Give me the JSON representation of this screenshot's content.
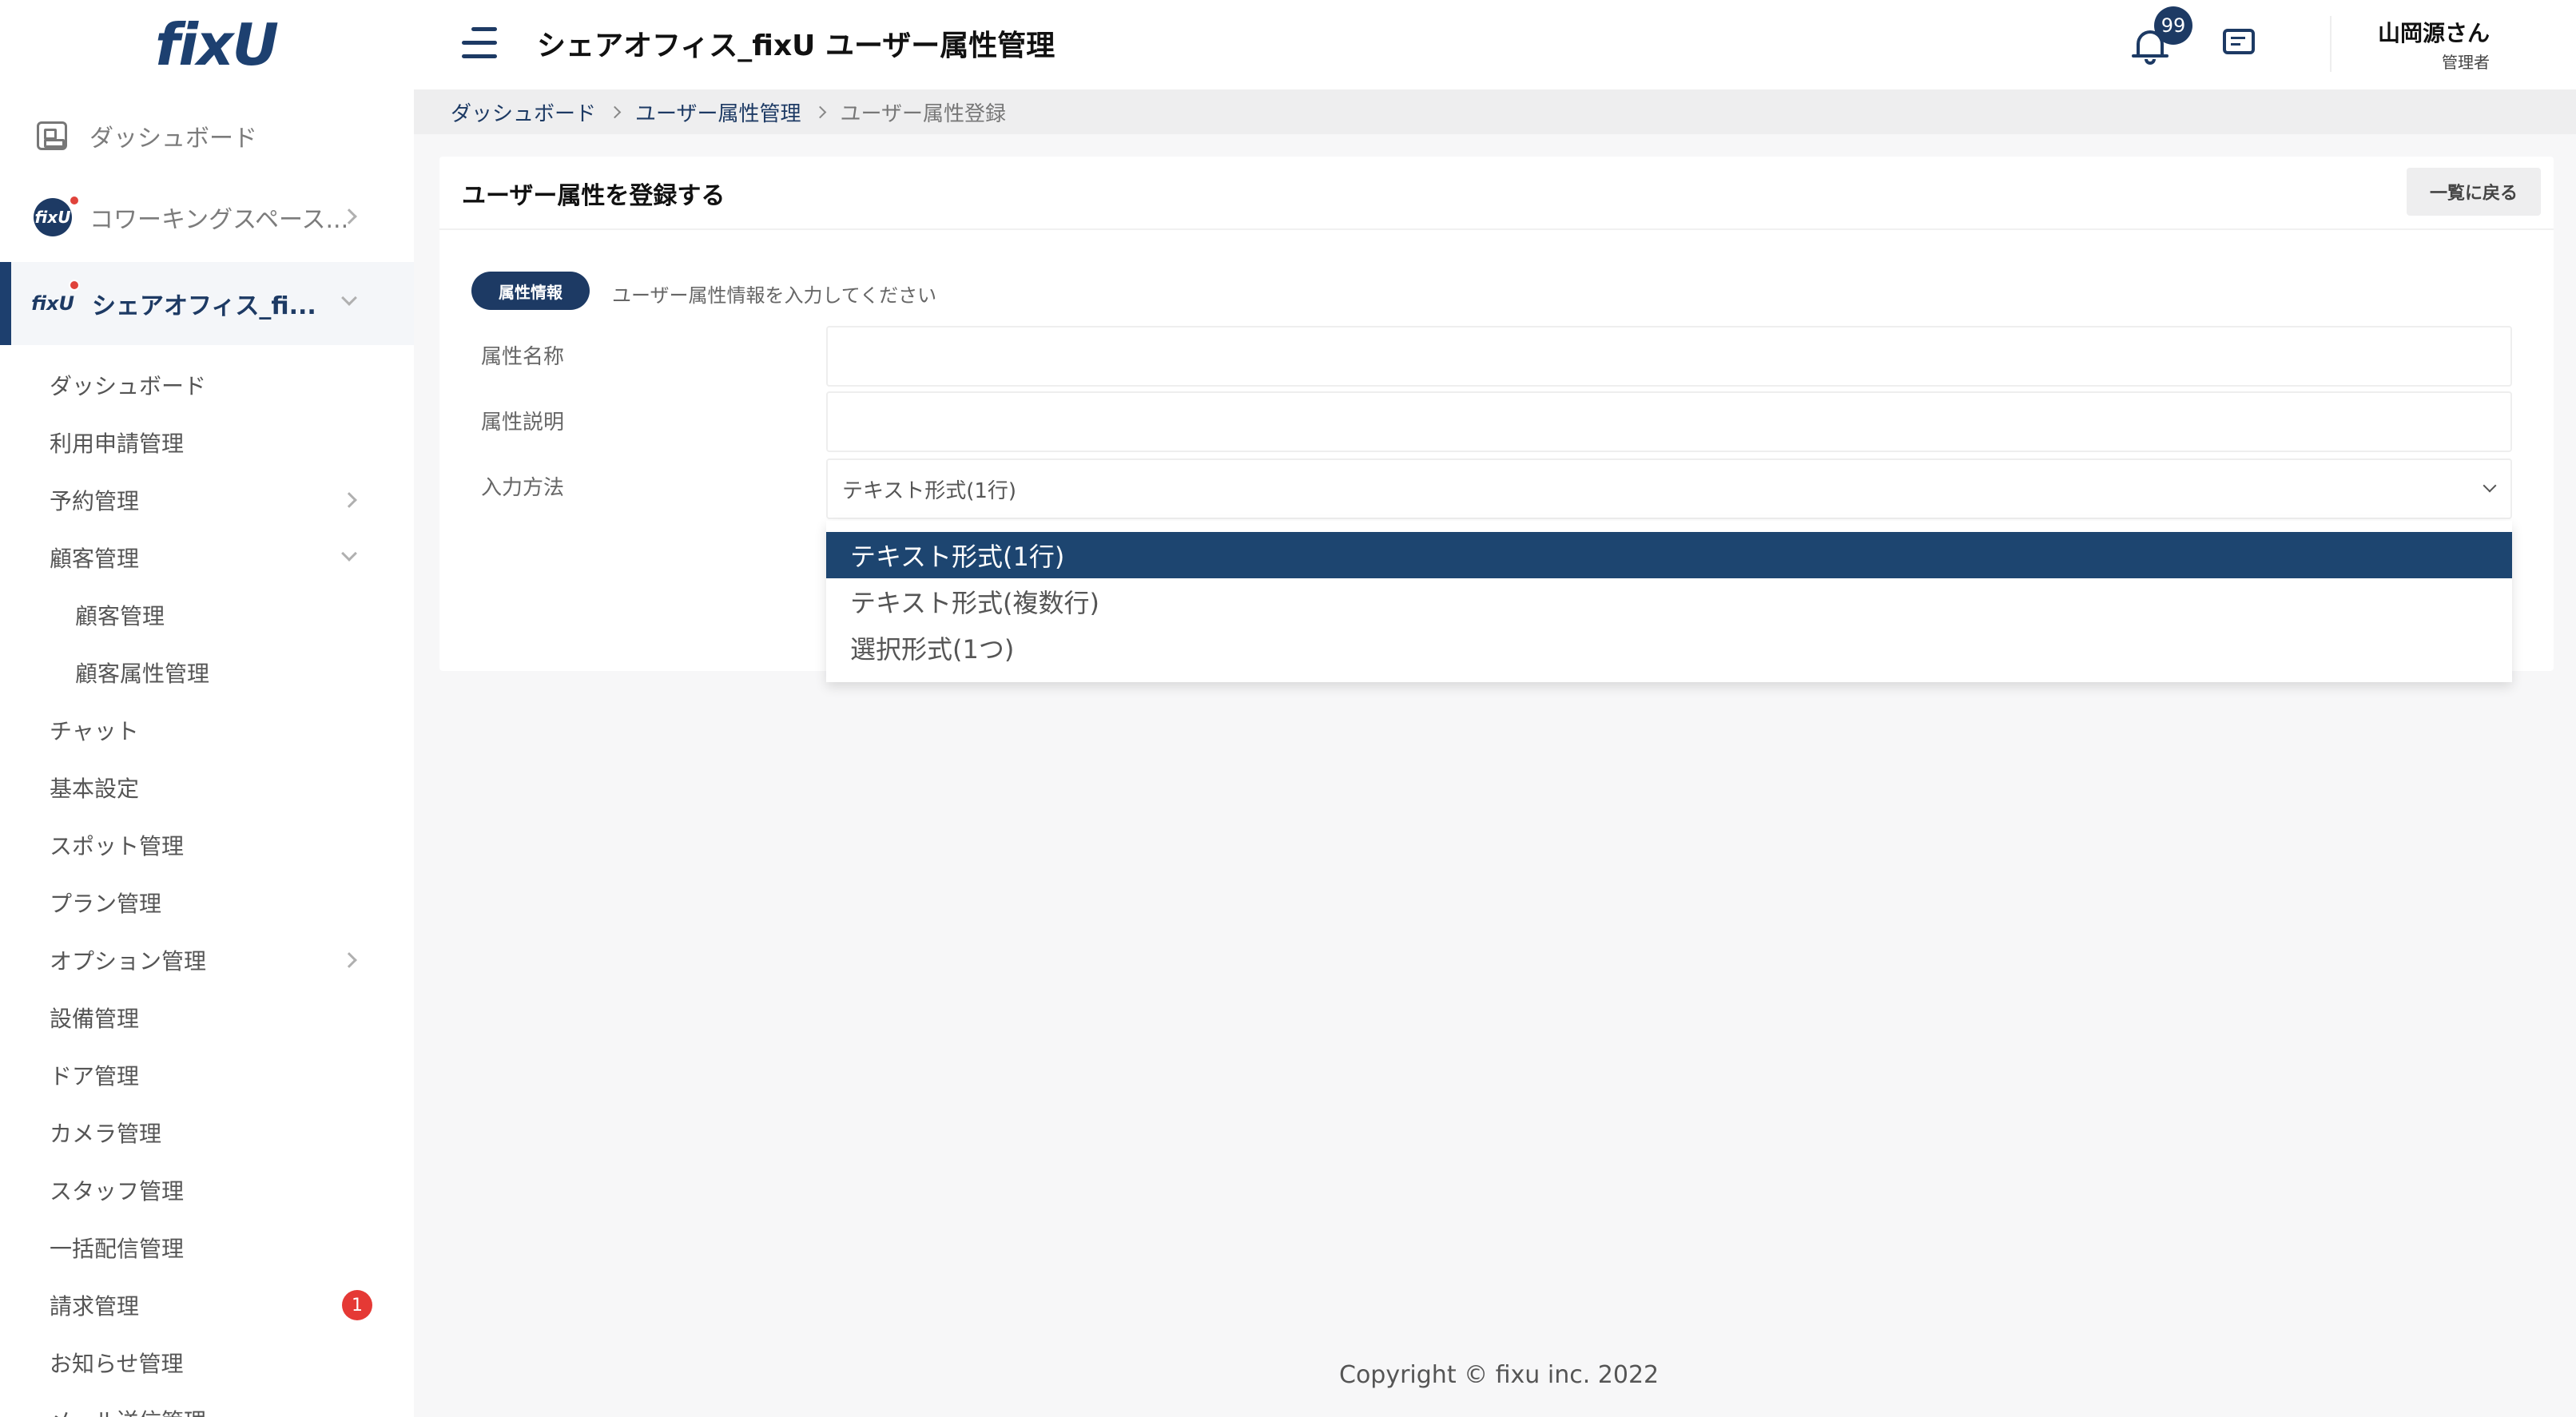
{
  "brand": {
    "logo_text": "fixU"
  },
  "sidebar": {
    "top_items": [
      {
        "label": "ダッシュボード",
        "icon": "dashboard-icon"
      },
      {
        "label": "コワーキングスペース...",
        "icon": "space-logo"
      },
      {
        "label": "シェアオフィス_fi...",
        "icon": "space-logo",
        "active": true
      }
    ],
    "space_logo_text": "fixU",
    "sub_items": [
      {
        "label": "ダッシュボード"
      },
      {
        "label": "利用申請管理"
      },
      {
        "label": "予約管理",
        "chevron": "right"
      },
      {
        "label": "顧客管理",
        "chevron": "down"
      },
      {
        "label": "顧客管理",
        "level": 2
      },
      {
        "label": "顧客属性管理",
        "level": 2
      },
      {
        "label": "チャット"
      },
      {
        "label": "基本設定"
      },
      {
        "label": "スポット管理"
      },
      {
        "label": "プラン管理"
      },
      {
        "label": "オプション管理",
        "chevron": "right"
      },
      {
        "label": "設備管理"
      },
      {
        "label": "ドア管理"
      },
      {
        "label": "カメラ管理"
      },
      {
        "label": "スタッフ管理"
      },
      {
        "label": "一括配信管理"
      },
      {
        "label": "請求管理",
        "badge": "1"
      },
      {
        "label": "お知らせ管理"
      },
      {
        "label": "メール送信管理"
      }
    ]
  },
  "header": {
    "title": "シェアオフィス_fixU ユーザー属性管理",
    "notification_count": "99",
    "user_name": "山岡源さん",
    "user_role": "管理者"
  },
  "breadcrumb": {
    "items": [
      "ダッシュボード",
      "ユーザー属性管理"
    ],
    "current": "ユーザー属性登録"
  },
  "card": {
    "title": "ユーザー属性を登録する",
    "back_label": "一覧に戻る",
    "section_pill": "属性情報",
    "section_desc": "ユーザー属性情報を入力してください",
    "fields": {
      "name_label": "属性名称",
      "name_value": "",
      "desc_label": "属性説明",
      "desc_value": "",
      "input_label": "入力方法",
      "input_value": "テキスト形式(1行)"
    },
    "dropdown_options": [
      "テキスト形式(1行)",
      "テキスト形式(複数行)",
      "選択形式(1つ)"
    ],
    "dropdown_selected_index": 0
  },
  "footer": {
    "copyright": "Copyright © fixu inc. 2022"
  },
  "colors": {
    "brand": "#1d3a64",
    "badge_red": "#e53935",
    "selected_option": "#1d4570"
  }
}
